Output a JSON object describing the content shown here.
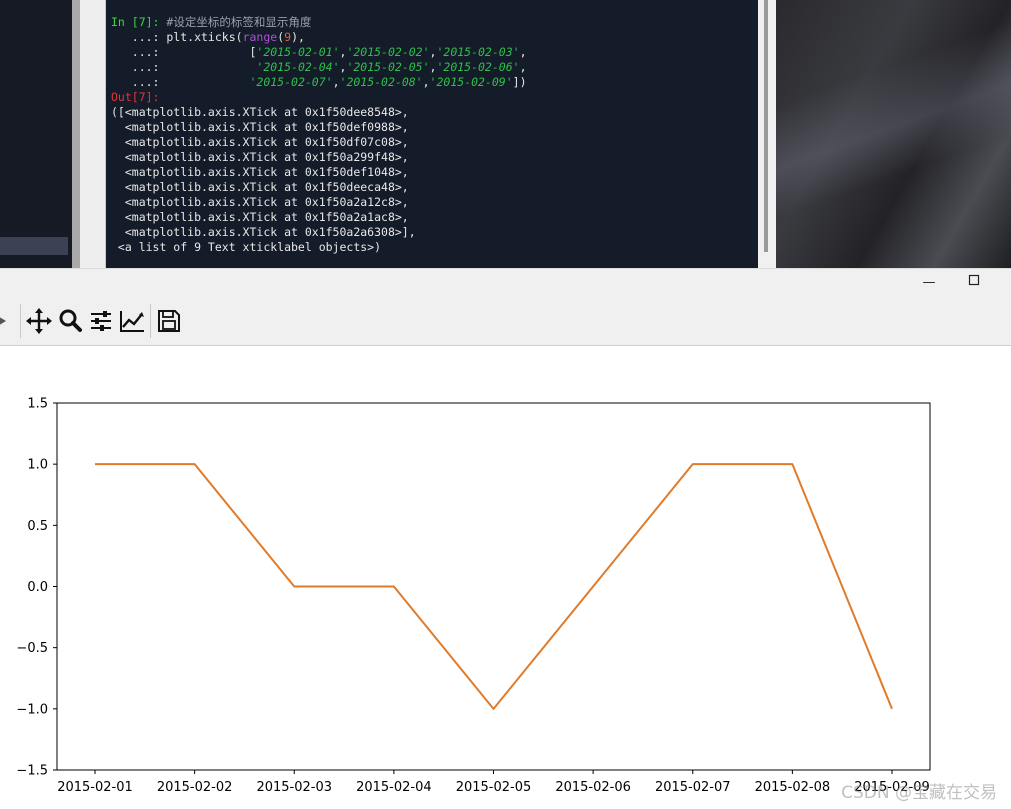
{
  "console": {
    "lines": [
      [
        {
          "t": "In [7]: ",
          "c": "in"
        },
        {
          "t": "#设定坐标的标签和显示角度",
          "c": "cmt"
        }
      ],
      [
        {
          "t": "   ...: plt.xticks(",
          "c": "p"
        },
        {
          "t": "range",
          "c": "fn"
        },
        {
          "t": "(",
          "c": "p"
        },
        {
          "t": "9",
          "c": "num"
        },
        {
          "t": "),",
          "c": "p"
        }
      ],
      [
        {
          "t": "   ...:             [",
          "c": "p"
        },
        {
          "t": "'2015-02-01'",
          "c": "str"
        },
        {
          "t": ",",
          "c": "p"
        },
        {
          "t": "'2015-02-02'",
          "c": "str"
        },
        {
          "t": ",",
          "c": "p"
        },
        {
          "t": "'2015-02-03'",
          "c": "str"
        },
        {
          "t": ",",
          "c": "p"
        }
      ],
      [
        {
          "t": "   ...:              ",
          "c": "p"
        },
        {
          "t": "'2015-02-04'",
          "c": "str"
        },
        {
          "t": ",",
          "c": "p"
        },
        {
          "t": "'2015-02-05'",
          "c": "str"
        },
        {
          "t": ",",
          "c": "p"
        },
        {
          "t": "'2015-02-06'",
          "c": "str"
        },
        {
          "t": ",",
          "c": "p"
        }
      ],
      [
        {
          "t": "   ...:             ",
          "c": "p"
        },
        {
          "t": "'2015-02-07'",
          "c": "str"
        },
        {
          "t": ",",
          "c": "p"
        },
        {
          "t": "'2015-02-08'",
          "c": "str"
        },
        {
          "t": ",",
          "c": "p"
        },
        {
          "t": "'2015-02-09'",
          "c": "str"
        },
        {
          "t": "])",
          "c": "p"
        }
      ],
      [
        {
          "t": "Out[7]:",
          "c": "out"
        }
      ],
      [
        {
          "t": "([<matplotlib.axis.XTick at 0x1f50dee8548>,",
          "c": "p"
        }
      ],
      [
        {
          "t": "  <matplotlib.axis.XTick at 0x1f50def0988>,",
          "c": "p"
        }
      ],
      [
        {
          "t": "  <matplotlib.axis.XTick at 0x1f50df07c08>,",
          "c": "p"
        }
      ],
      [
        {
          "t": "  <matplotlib.axis.XTick at 0x1f50a299f48>,",
          "c": "p"
        }
      ],
      [
        {
          "t": "  <matplotlib.axis.XTick at 0x1f50def1048>,",
          "c": "p"
        }
      ],
      [
        {
          "t": "  <matplotlib.axis.XTick at 0x1f50deeca48>,",
          "c": "p"
        }
      ],
      [
        {
          "t": "  <matplotlib.axis.XTick at 0x1f50a2a12c8>,",
          "c": "p"
        }
      ],
      [
        {
          "t": "  <matplotlib.axis.XTick at 0x1f50a2a1ac8>,",
          "c": "p"
        }
      ],
      [
        {
          "t": "  <matplotlib.axis.XTick at 0x1f50a2a6308>],",
          "c": "p"
        }
      ],
      [
        {
          "t": " <a list of 9 Text xticklabel objects>)",
          "c": "p"
        }
      ]
    ]
  },
  "window": {
    "minimize_glyph": "—",
    "maximize_glyph": "☐"
  },
  "toolbar": {
    "icons": [
      "forward-arrow-icon",
      "pan-move-icon",
      "zoom-magnifier-icon",
      "configure-subplots-icon",
      "edit-axis-line-icon",
      "save-floppy-icon"
    ]
  },
  "chart_data": {
    "type": "line",
    "x": [
      "2015-02-01",
      "2015-02-02",
      "2015-02-03",
      "2015-02-04",
      "2015-02-05",
      "2015-02-06",
      "2015-02-07",
      "2015-02-08",
      "2015-02-09"
    ],
    "series": [
      {
        "values": [
          1,
          1,
          0,
          0,
          -1,
          0,
          1,
          1,
          -1
        ],
        "color": "#e07b2a"
      }
    ],
    "yticks": [
      "1.5",
      "1.0",
      "0.5",
      "0.0",
      "−0.5",
      "−1.0",
      "−1.5"
    ],
    "ylim": [
      -1.5,
      1.5
    ],
    "title": "",
    "xlabel": "",
    "ylabel": "",
    "grid": false,
    "legend": "none"
  },
  "watermark": "CSDN @宝藏在交易"
}
